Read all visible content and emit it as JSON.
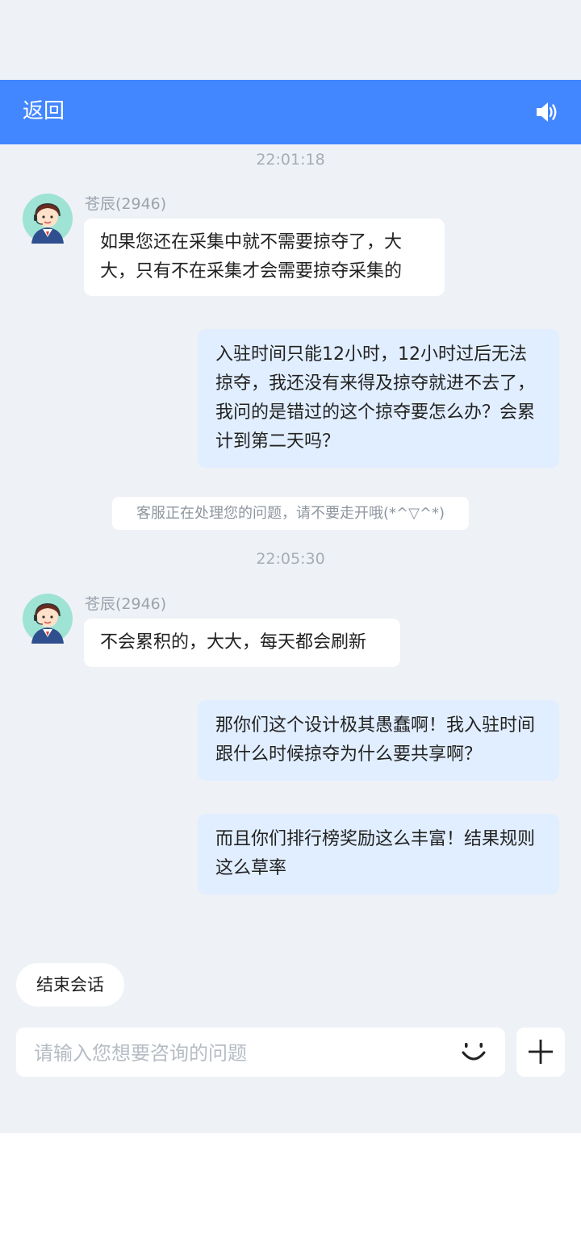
{
  "header": {
    "back_label": "返回",
    "speaker_icon": "speaker-icon"
  },
  "colors": {
    "header_bg": "#4287ff",
    "user_bubble": "#e1eeff",
    "page_bg": "#eef1f5"
  },
  "messages": [
    {
      "kind": "time",
      "text": "22:01:18"
    },
    {
      "kind": "agent",
      "name": "苍辰(2946)",
      "text": "如果您还在采集中就不需要掠夺了，大大，只有不在采集才会需要掠夺采集的"
    },
    {
      "kind": "user",
      "text": "入驻时间只能12小时，12小时过后无法掠夺，我还没有来得及掠夺就进不去了，我问的是错过的这个掠夺要怎么办？会累计到第二天吗？"
    },
    {
      "kind": "system",
      "text": "客服正在处理您的问题，请不要走开哦(*^▽^*)"
    },
    {
      "kind": "time",
      "text": "22:05:30"
    },
    {
      "kind": "agent",
      "name": "苍辰(2946)",
      "text": "不会累积的，大大，每天都会刷新"
    },
    {
      "kind": "user",
      "text": "那你们这个设计极其愚蠢啊！我入驻时间跟什么时候掠夺为什么要共享啊？"
    },
    {
      "kind": "user",
      "text": "而且你们排行榜奖励这么丰富！结果规则这么草率"
    }
  ],
  "footer": {
    "end_session_label": "结束会话",
    "input_placeholder": "请输入您想要咨询的问题",
    "input_value": ""
  }
}
